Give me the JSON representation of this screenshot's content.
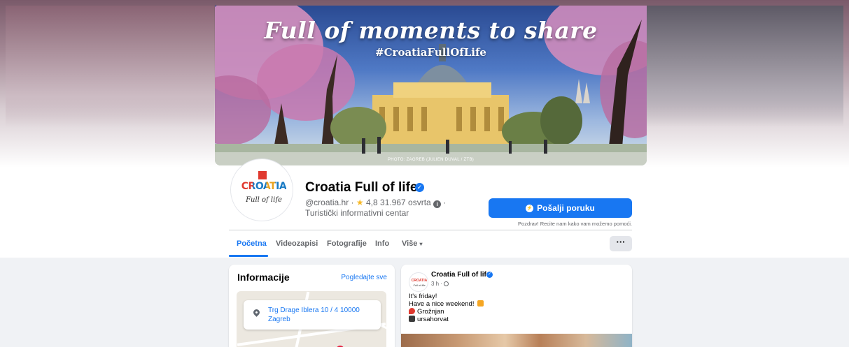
{
  "cover": {
    "headline": "Full of moments to share",
    "hashtag": "#CroatiaFullOfLife",
    "credit": "PHOTO: ZAGREB (JULIEN DUVAL / ZTB)"
  },
  "profile": {
    "avatar_logo_top": "CROATIA",
    "avatar_logo_bottom": "Full of life",
    "name": "Croatia Full of life",
    "handle": "@croatia.hr",
    "rating": "4,8",
    "reviews": "31.967 osvrta",
    "category": "Turistički informativni centar",
    "message_button": "Pošalji poruku",
    "message_hint": "Pozdrav! Recite nam kako vam možemo pomoći."
  },
  "tabs": [
    {
      "label": "Početna",
      "active": true
    },
    {
      "label": "Videozapisi",
      "active": false
    },
    {
      "label": "Fotografije",
      "active": false
    },
    {
      "label": "Info",
      "active": false
    },
    {
      "label": "Više",
      "active": false
    }
  ],
  "more_button": "···",
  "info_card": {
    "title": "Informacije",
    "see_all": "Pogledajte sve",
    "address": "Trg Drage Iblera 10 / 4 10000 Zagreb"
  },
  "post": {
    "author": "Croatia Full of life",
    "time": "3 h ·",
    "lines": [
      "It's friday!",
      "Have a nice weekend!",
      "Grožnjan",
      "ursahorvat"
    ]
  },
  "colors": {
    "accent": "#1877f2",
    "page_bg": "#f0f2f5",
    "text_secondary": "#65676b"
  }
}
